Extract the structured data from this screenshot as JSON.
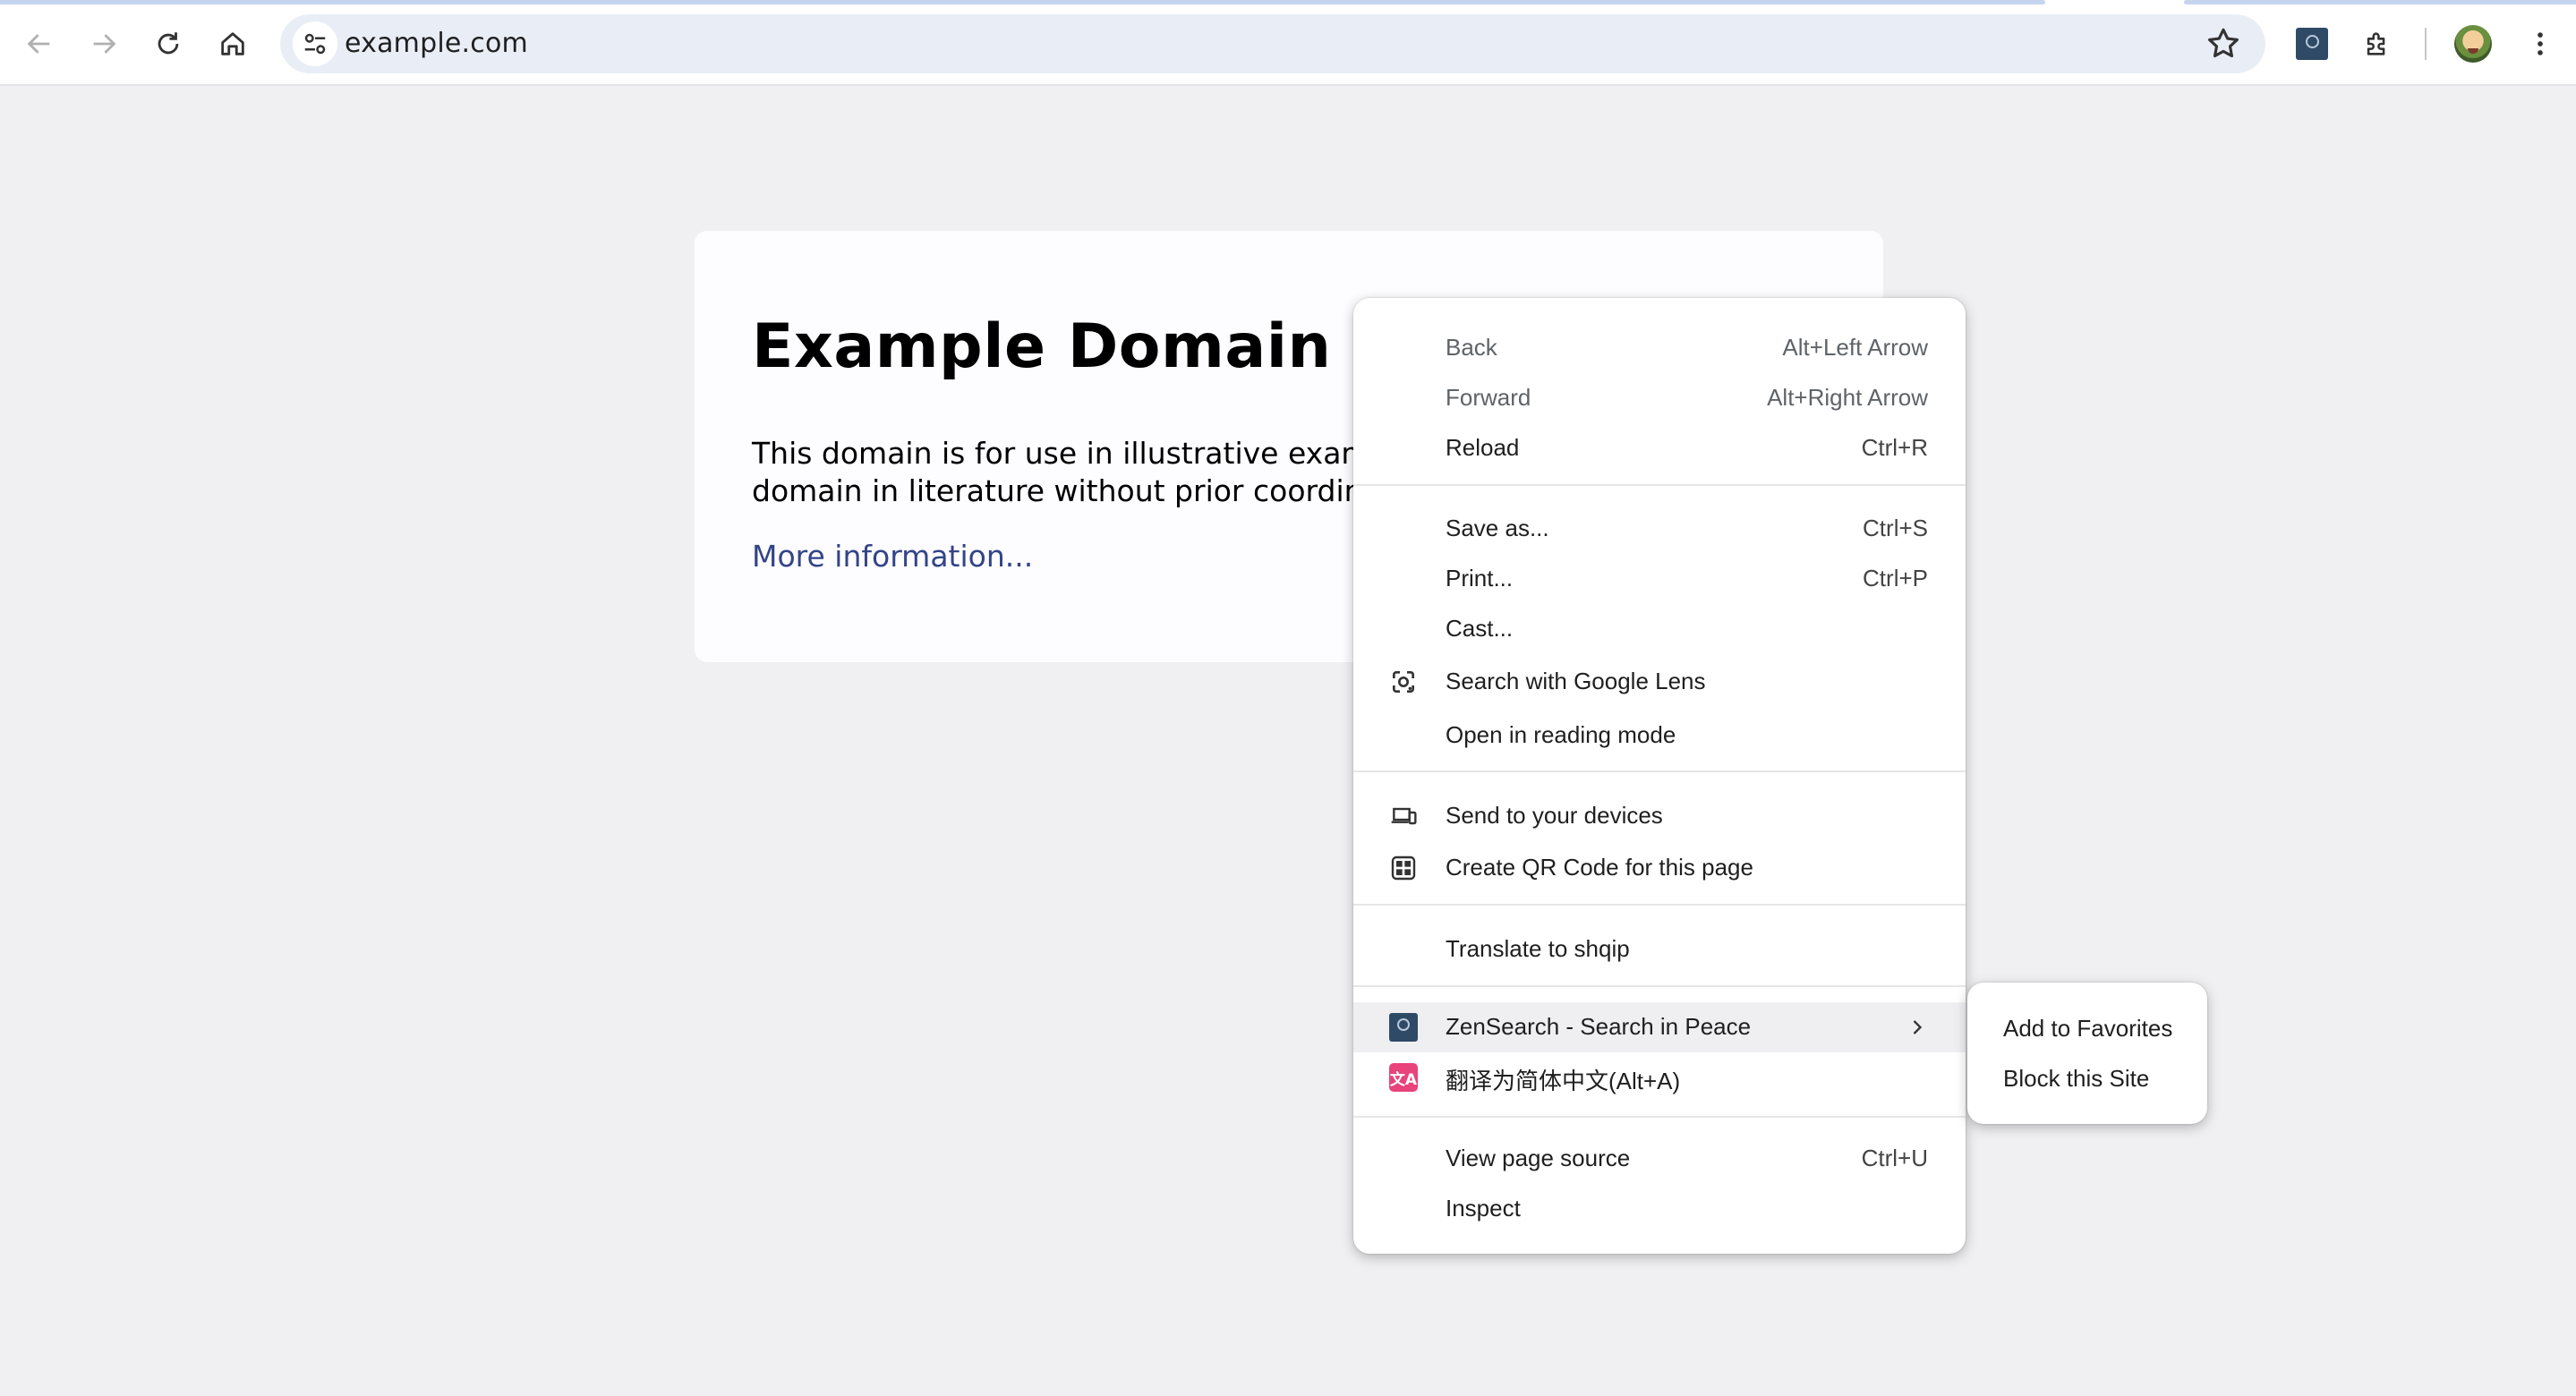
{
  "toolbar": {
    "url": "example.com",
    "icons": [
      "back-arrow-icon",
      "forward-arrow-icon",
      "reload-icon",
      "home-icon",
      "site-info-icon",
      "bookmark-star-icon",
      "zensearch-extension-icon",
      "extensions-puzzle-icon",
      "profile-avatar",
      "more-menu-icon"
    ]
  },
  "page": {
    "title": "Example Domain",
    "line1": "This domain is for use in illustrative example",
    "line2": "domain in literature without prior coordinati",
    "link": "More information..."
  },
  "menu": {
    "items": [
      {
        "label": "Back",
        "shortcut": "Alt+Left Arrow",
        "disabled": true
      },
      {
        "label": "Forward",
        "shortcut": "Alt+Right Arrow",
        "disabled": true
      },
      {
        "label": "Reload",
        "shortcut": "Ctrl+R"
      },
      {
        "label": "Save as...",
        "shortcut": "Ctrl+S"
      },
      {
        "label": "Print...",
        "shortcut": "Ctrl+P"
      },
      {
        "label": "Cast..."
      },
      {
        "label": "Search with Google Lens",
        "icon": "google-lens-icon"
      },
      {
        "label": "Open in reading mode"
      },
      {
        "label": "Send to your devices",
        "icon": "send-to-devices-icon"
      },
      {
        "label": "Create QR Code for this page",
        "icon": "qr-code-icon"
      },
      {
        "label": "Translate to shqip"
      },
      {
        "label": "ZenSearch - Search in Peace",
        "icon": "zensearch-icon",
        "has_submenu": true
      },
      {
        "label": "翻译为简体中文(Alt+A)",
        "icon": "translate-icon",
        "icon_text": "文A"
      },
      {
        "label": "View page source",
        "shortcut": "Ctrl+U"
      },
      {
        "label": "Inspect"
      }
    ]
  },
  "submenu": {
    "items": [
      "Add to Favorites",
      "Block this Site"
    ]
  },
  "colors": {
    "background": "#f0f0f2",
    "omnibox": "#e9eef6",
    "link": "#334488",
    "highlight": "#efeff2",
    "translate_icon": "#e8437a"
  }
}
